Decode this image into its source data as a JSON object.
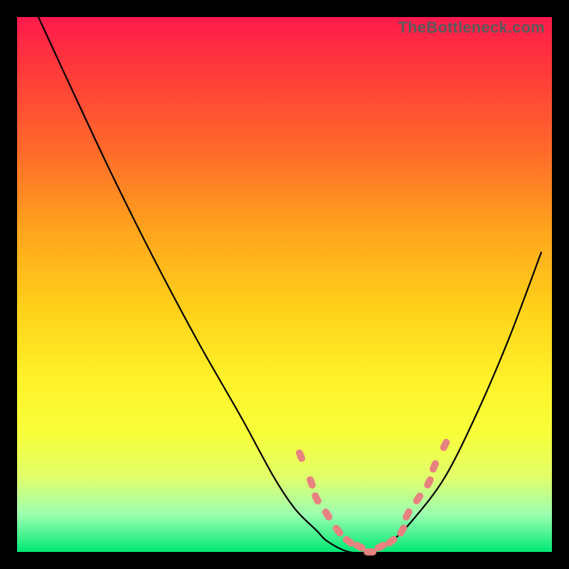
{
  "watermark": "TheBottleneck.com",
  "colors": {
    "top": "#ff1a4d",
    "bottom": "#00e874",
    "curve": "#000000",
    "markers": "#e88280",
    "frame": "#000000"
  },
  "chart_data": {
    "type": "line",
    "title": "",
    "xlabel": "",
    "ylabel": "",
    "xlim": [
      0,
      100
    ],
    "ylim": [
      0,
      100
    ],
    "grid": false,
    "legend": false,
    "series": [
      {
        "name": "curve",
        "x": [
          4,
          10,
          18,
          26,
          34,
          42,
          48,
          52,
          56,
          58,
          62,
          66,
          70,
          74,
          80,
          86,
          92,
          98
        ],
        "y": [
          100,
          87,
          70,
          54,
          39,
          25,
          14,
          8,
          4,
          2,
          0,
          0,
          2,
          6,
          14,
          26,
          40,
          56
        ]
      }
    ],
    "markers": {
      "name": "highlighted-points",
      "x": [
        53,
        55,
        56,
        58,
        60,
        62,
        64,
        66,
        68,
        70,
        72,
        73,
        75,
        77,
        78,
        80
      ],
      "y": [
        18,
        13,
        10,
        7,
        4,
        2,
        1,
        0,
        1,
        2,
        4,
        7,
        10,
        13,
        16,
        20
      ]
    }
  }
}
